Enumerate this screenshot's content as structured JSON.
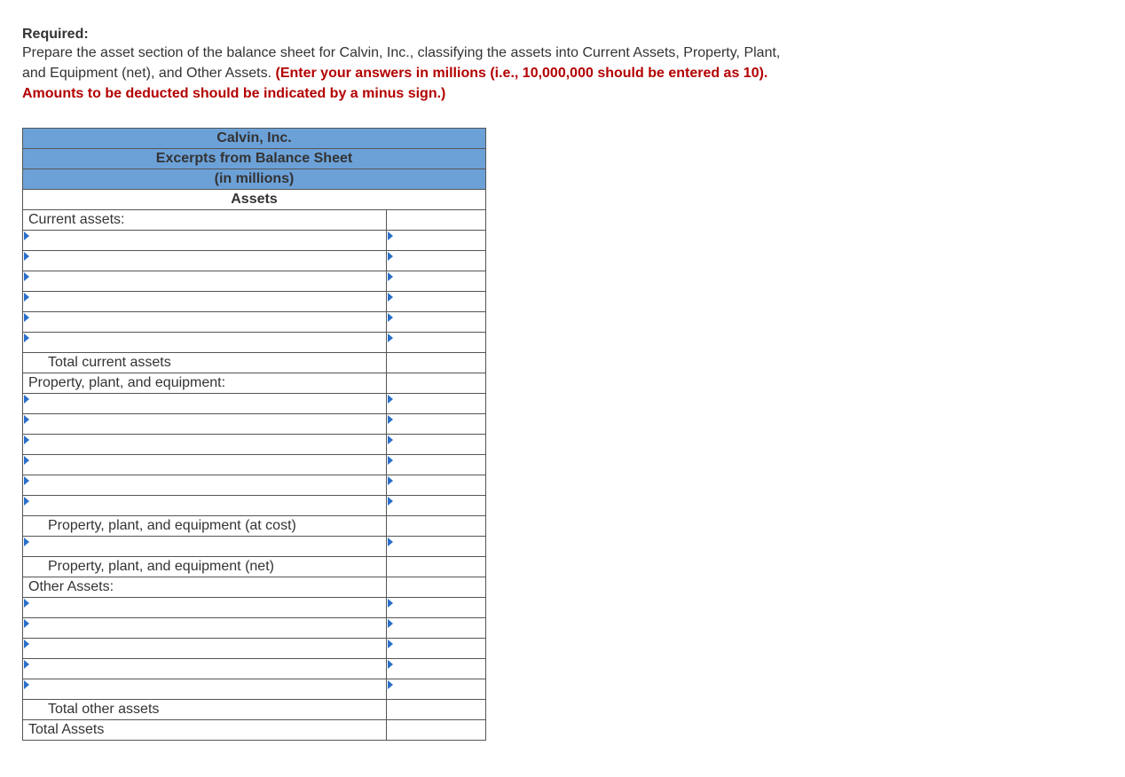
{
  "header": {
    "required_label": "Required:",
    "line1": "Prepare the asset section of the balance sheet for Calvin, Inc., classifying the assets into Current Assets, Property, Plant,",
    "line2a": "and Equipment (net), and Other Assets. ",
    "line2b": "(Enter your answers in millions (i.e., 10,000,000 should be entered as 10).",
    "line3": "Amounts to be deducted should be indicated by a minus sign.)"
  },
  "sheet": {
    "company": "Calvin, Inc.",
    "subtitle": "Excerpts from Balance Sheet",
    "units": "(in millions)",
    "section_title": "Assets",
    "rows": {
      "current_assets_heading": "Current assets:",
      "total_current_assets": "Total current assets",
      "ppe_heading": "Property, plant, and equipment:",
      "ppe_at_cost": "Property, plant, and equipment (at cost)",
      "ppe_net": "Property, plant, and equipment (net)",
      "other_assets_heading": "Other Assets:",
      "total_other_assets": "Total other assets",
      "total_assets": "Total Assets"
    }
  }
}
